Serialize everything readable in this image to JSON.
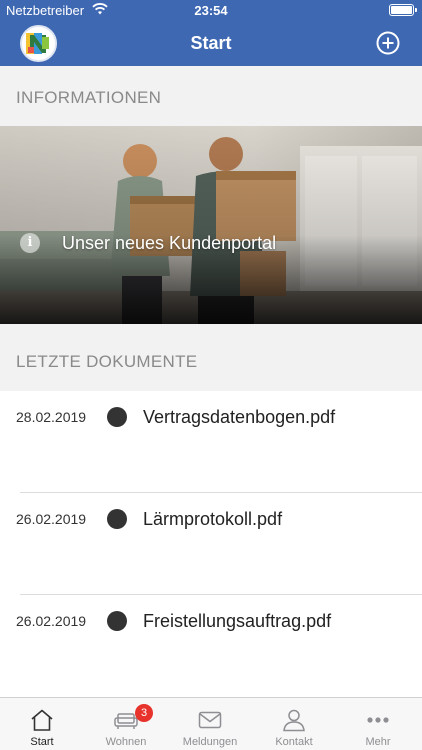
{
  "status_bar": {
    "carrier": "Netzbetreiber",
    "time": "23:54"
  },
  "nav": {
    "title": "Start"
  },
  "sections": {
    "info_title": "INFORMATIONEN",
    "docs_title": "LETZTE DOKUMENTE"
  },
  "hero": {
    "caption": "Unser neues Kundenportal"
  },
  "documents": [
    {
      "date": "28.02.2019",
      "name": "Vertragsdatenbogen.pdf"
    },
    {
      "date": "26.02.2019",
      "name": "Lärmprotokoll.pdf"
    },
    {
      "date": "26.02.2019",
      "name": "Freistellungsauftrag.pdf"
    }
  ],
  "tabs": [
    {
      "label": "Start",
      "icon": "home-icon",
      "active": true
    },
    {
      "label": "Wohnen",
      "icon": "sofa-icon",
      "badge": "3"
    },
    {
      "label": "Meldungen",
      "icon": "envelope-icon"
    },
    {
      "label": "Kontakt",
      "icon": "person-icon"
    },
    {
      "label": "Mehr",
      "icon": "more-icon"
    }
  ],
  "colors": {
    "accent": "#3f68b3",
    "badge": "#e8322c"
  }
}
